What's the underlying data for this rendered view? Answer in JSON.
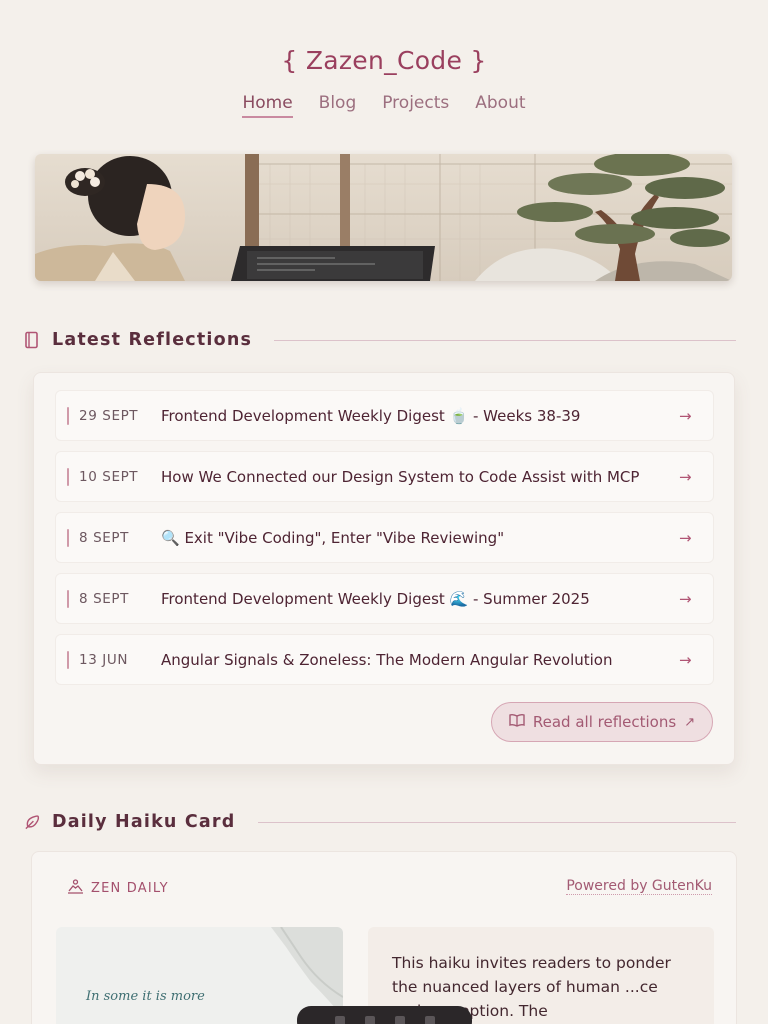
{
  "site": {
    "title": "{ Zazen_Code }"
  },
  "nav": {
    "items": [
      "Home",
      "Blog",
      "Projects",
      "About"
    ],
    "active": "Home"
  },
  "reflections": {
    "heading": "Latest Reflections",
    "posts": [
      {
        "date": "29 SEPT",
        "title": "Frontend Development Weekly Digest 🍵 - Weeks 38-39"
      },
      {
        "date": "10 SEPT",
        "title": "How We Connected our Design System to Code Assist with MCP"
      },
      {
        "date": "8 SEPT",
        "title": "🔍 Exit \"Vibe Coding\", Enter \"Vibe Reviewing\""
      },
      {
        "date": "8 SEPT",
        "title": "Frontend Development Weekly Digest 🌊 - Summer 2025"
      },
      {
        "date": "13 JUN",
        "title": "Angular Signals & Zoneless: The Modern Angular Revolution"
      }
    ],
    "read_all_label": "Read all reflections"
  },
  "haiku": {
    "heading": "Daily Haiku Card",
    "badge": "ZEN DAILY",
    "powered_by": "Powered by GutenKu",
    "image_text": "In some it is more",
    "description": "This haiku invites readers to ponder the nuanced layers of human ...ce and perception. The"
  },
  "colors": {
    "accent": "#9a3f5e",
    "background": "#f4f0eb",
    "card": "#f8f5f2"
  },
  "icons": {
    "reflections": "book-icon",
    "haiku": "feather-icon",
    "zen": "meditation-icon",
    "post_arrow": "arrow-right-icon",
    "read_all": "open-book-icon"
  }
}
